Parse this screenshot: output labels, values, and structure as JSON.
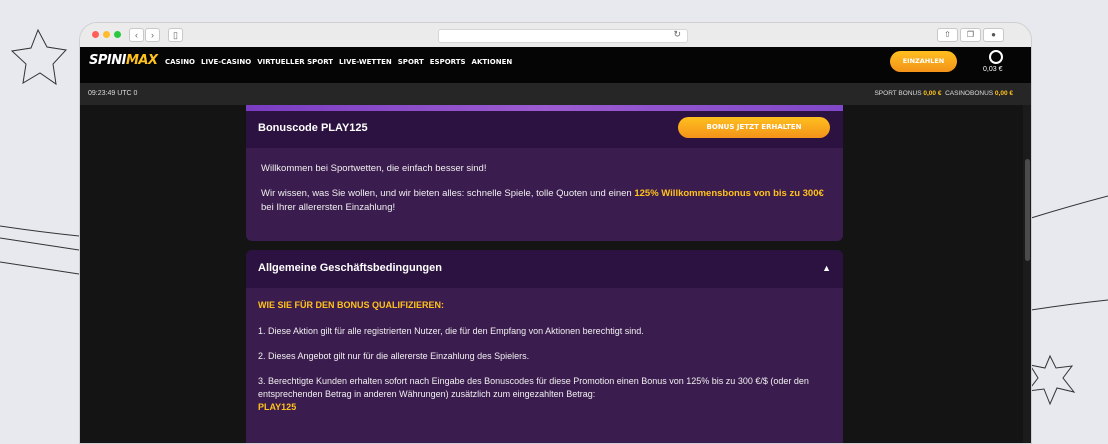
{
  "site": {
    "logo": {
      "part1": "SPINI",
      "part2": "MAX"
    },
    "nav": [
      "CASINO",
      "LIVE-CASINO",
      "VIRTUELLER SPORT",
      "LIVE-WETTEN",
      "SPORT",
      "ESPORTS",
      "AKTIONEN"
    ],
    "deposit_label": "EINZAHLEN",
    "balance": "0,03 €",
    "clock": "09:23:49 UTC 0",
    "sport_bonus_label": "SPORT BONUS",
    "sport_bonus_value": "0,00 €",
    "casino_bonus_label": "CASINOBONUS",
    "casino_bonus_value": "0,00 €"
  },
  "promo": {
    "code_title": "Bonuscode PLAY125",
    "claim_label": "BONUS JETZT ERHALTEN",
    "welcome": "Willkommen bei Sportwetten, die einfach besser sind!",
    "intro_pre": "Wir wissen, was Sie wollen, und wir bieten alles: schnelle Spiele, tolle Quoten und einen",
    "intro_highlight": "125% Willkommensbonus von bis zu 300€",
    "intro_post": "bei Ihrer allerersten Einzahlung!"
  },
  "terms": {
    "title": "Allgemeine Geschäftsbedingungen",
    "toggle_icon": "▲",
    "qualify_heading": "WIE SIE FÜR DEN BONUS QUALIFIZIEREN:",
    "item1": "1. Diese Aktion gilt für alle registrierten Nutzer, die für den Empfang von Aktionen berechtigt sind.",
    "item2": "2. Dieses Angebot gilt nur für die allererste Einzahlung des Spielers.",
    "item3": "3. Berechtigte Kunden erhalten sofort nach Eingabe des Bonuscodes für diese Promotion einen Bonus von 125% bis zu 300 €/$ (oder den entsprechenden Betrag in anderen Währungen) zusätzlich zum eingezahlten Betrag:",
    "item3_code": "PLAY125"
  },
  "colors": {
    "accent": "#ffc21c",
    "card": "#3b1c4e",
    "card_header": "#2c1240"
  }
}
